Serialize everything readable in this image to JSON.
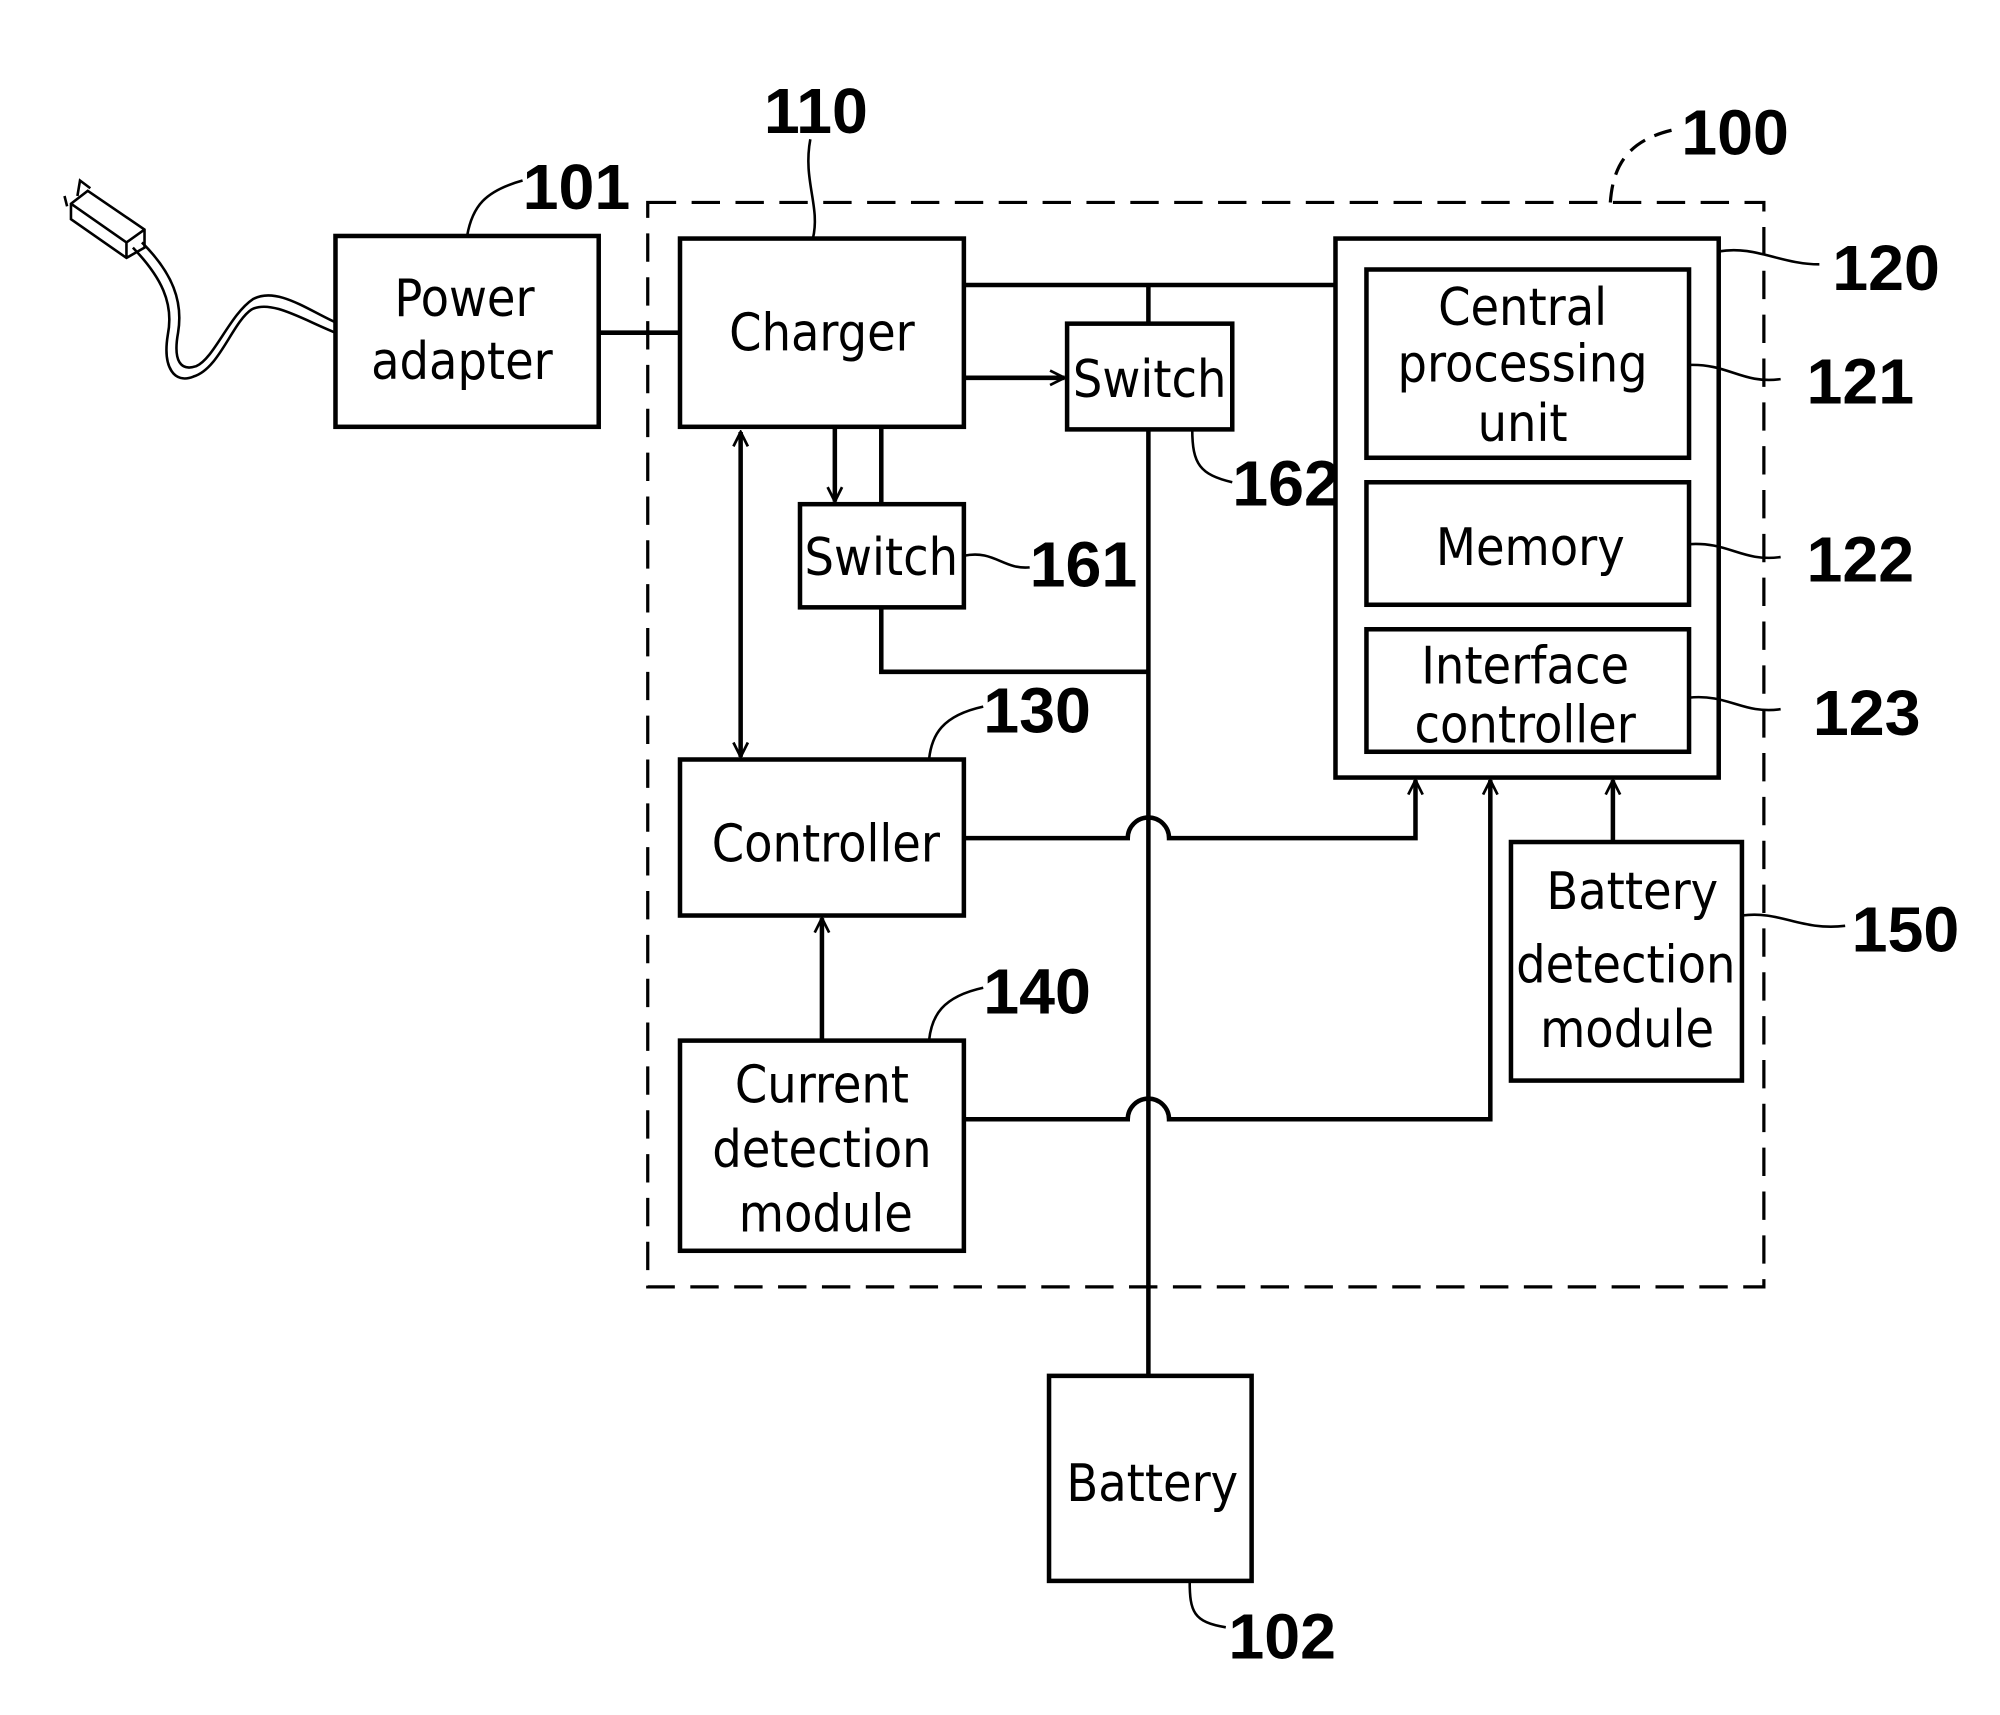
{
  "figure": {
    "system_ref": "100",
    "blocks": {
      "power_adapter": {
        "ref": "101",
        "lines": [
          "Power",
          "adapter"
        ]
      },
      "battery": {
        "ref": "102",
        "lines": [
          "Battery"
        ]
      },
      "charger": {
        "ref": "110",
        "lines": [
          "Charger"
        ]
      },
      "processing_module": {
        "ref": "120"
      },
      "cpu": {
        "ref": "121",
        "lines": [
          "Central",
          "processing",
          "unit"
        ]
      },
      "memory": {
        "ref": "122",
        "lines": [
          "Memory"
        ]
      },
      "interface_controller": {
        "ref": "123",
        "lines": [
          "Interface",
          "controller"
        ]
      },
      "controller": {
        "ref": "130",
        "lines": [
          "Controller"
        ]
      },
      "current_detection": {
        "ref": "140",
        "lines": [
          "Current",
          "detection",
          "module"
        ]
      },
      "battery_detection": {
        "ref": "150",
        "lines": [
          "Battery",
          "detection",
          "module"
        ]
      },
      "switch_161": {
        "ref": "161",
        "lines": [
          "Switch"
        ]
      },
      "switch_162": {
        "ref": "162",
        "lines": [
          "Switch"
        ]
      }
    }
  }
}
